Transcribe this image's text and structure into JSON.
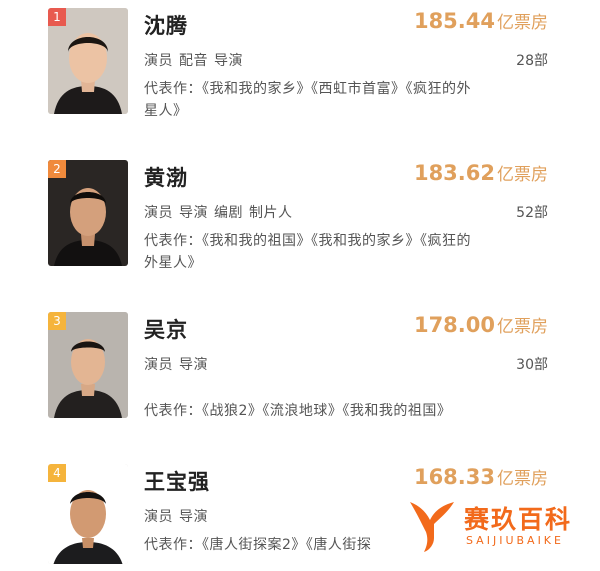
{
  "entries": [
    {
      "rank": "1",
      "rank_color": "#e85a4f",
      "name": "沈腾",
      "box_office": "185.44",
      "unit": "亿票房",
      "roles": [
        "演员",
        "配音",
        "导演"
      ],
      "film_count": "28部",
      "works_label": "代表作：",
      "works_line1": "《我和我的家乡》《西虹市首富》《疯狂的外",
      "works_line2": "星人》"
    },
    {
      "rank": "2",
      "rank_color": "#f08a3c",
      "name": "黄渤",
      "box_office": "183.62",
      "unit": "亿票房",
      "roles": [
        "演员",
        "导演",
        "编剧",
        "制片人"
      ],
      "film_count": "52部",
      "works_label": "代表作：",
      "works_line1": "《我和我的祖国》《我和我的家乡》《疯狂的",
      "works_line2": "外星人》"
    },
    {
      "rank": "3",
      "rank_color": "#f5b43c",
      "name": "吴京",
      "box_office": "178.00",
      "unit": "亿票房",
      "roles": [
        "演员",
        "导演"
      ],
      "film_count": "30部",
      "works_label": "代表作：",
      "works_line1": "《战狼2》《流浪地球》《我和我的祖国》"
    },
    {
      "rank": "4",
      "rank_color": "#f5b43c",
      "name": "王宝强",
      "box_office": "168.33",
      "unit": "亿票房",
      "roles": [
        "演员",
        "导演"
      ],
      "works_label": "代表作：",
      "works_line1": "《唐人街探案2》《唐人街探"
    }
  ],
  "watermark": {
    "title": "赛玖百科",
    "subtitle": "SAIJIUBAIKE",
    "color": "#f26a1b"
  }
}
